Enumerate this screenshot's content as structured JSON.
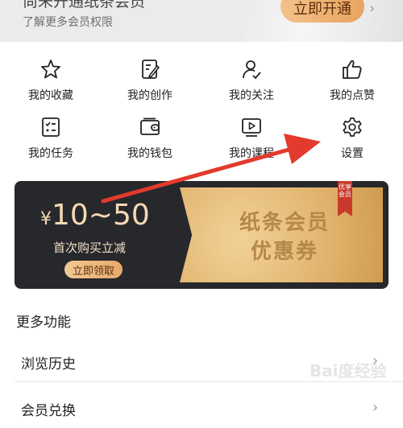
{
  "top_banner": {
    "title": "尚未开通纸条会员",
    "subtitle": "了解更多会员权限",
    "open_button": "立即开通"
  },
  "grid": [
    {
      "label": "我的收藏",
      "icon": "star-icon"
    },
    {
      "label": "我的创作",
      "icon": "edit-icon"
    },
    {
      "label": "我的关注",
      "icon": "user-follow-icon"
    },
    {
      "label": "我的点赞",
      "icon": "thumbs-up-icon"
    },
    {
      "label": "我的任务",
      "icon": "task-list-icon"
    },
    {
      "label": "我的钱包",
      "icon": "wallet-icon"
    },
    {
      "label": "我的课程",
      "icon": "video-play-icon"
    },
    {
      "label": "设置",
      "icon": "gear-icon"
    }
  ],
  "coupon": {
    "currency": "¥",
    "price": "10~50",
    "desc": "首次购买立减",
    "claim_button": "立即领取",
    "voucher_line1": "纸条会员",
    "voucher_line2": "优惠券",
    "ribbon": "优享会员"
  },
  "more": {
    "title": "更多功能",
    "items": [
      "浏览历史",
      "会员兑换"
    ]
  },
  "watermark": "Bai度经验",
  "colors": {
    "arrow": "#e23a2c",
    "accent": "#e8a460",
    "banner_dark": "#27282c"
  }
}
